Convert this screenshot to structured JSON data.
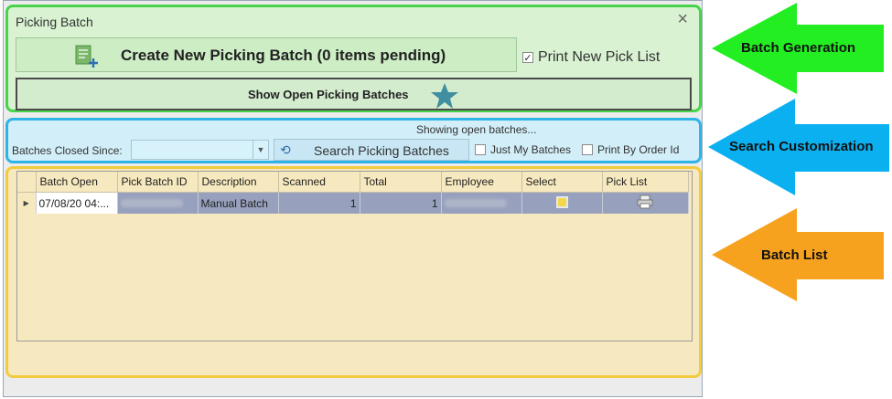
{
  "window": {
    "title": "Picking Batch",
    "close_glyph": "×"
  },
  "generation": {
    "create_label": "Create New Picking Batch (0 items pending)",
    "create_icon": "new-document-icon",
    "print_new_pick_list_label": "Print New Pick List",
    "print_new_pick_list_checked": true,
    "show_open_label": "Show Open Picking Batches",
    "show_open_icon": "star-icon"
  },
  "search": {
    "status_text": "Showing open batches...",
    "closed_since_label": "Batches Closed Since:",
    "closed_since_value": "",
    "search_button_label": "Search Picking Batches",
    "search_icon": "refresh-icon",
    "just_my_batches_label": "Just My Batches",
    "just_my_batches_checked": false,
    "print_by_order_id_label": "Print By Order Id",
    "print_by_order_id_checked": false
  },
  "grid": {
    "columns": [
      "Batch Open",
      "Pick Batch ID",
      "Description",
      "Scanned",
      "Total",
      "Employee",
      "Select",
      "Pick List"
    ],
    "rows": [
      {
        "batch_open": "07/08/20 04:...",
        "pick_batch_id": "",
        "description": "Manual Batch",
        "scanned": "1",
        "total": "1",
        "employee": ""
      }
    ]
  },
  "annotations": {
    "batch_generation": "Batch Generation",
    "search_customization": "Search Customization",
    "batch_list": "Batch List"
  },
  "colors": {
    "generation_border": "#47d44a",
    "search_border": "#2fb4e8",
    "list_border": "#f2cb3f",
    "green_arrow": "#22ee22",
    "blue_arrow": "#0bb0f0",
    "orange_arrow": "#f7a21f"
  }
}
